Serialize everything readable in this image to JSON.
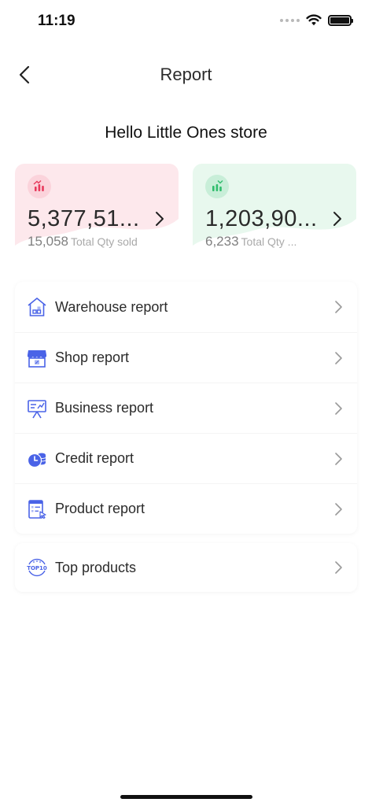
{
  "status_bar": {
    "time": "11:19"
  },
  "nav": {
    "title": "Report"
  },
  "greeting": "Hello Little Ones store",
  "cards": [
    {
      "amount": "5,377,51...",
      "qty": "15,058",
      "label": "Total Qty sold",
      "icon": "bar-chart-up-icon",
      "color": "#fde8ec",
      "accent": "#e8395c"
    },
    {
      "amount": "1,203,90...",
      "qty": "6,233",
      "label": "Total Qty ...",
      "icon": "bar-chart-down-icon",
      "color": "#e8f8ee",
      "accent": "#2fbd6c"
    }
  ],
  "reports": [
    {
      "label": "Warehouse report",
      "icon": "warehouse-icon"
    },
    {
      "label": "Shop report",
      "icon": "shop-icon"
    },
    {
      "label": "Business report",
      "icon": "presentation-board-icon"
    },
    {
      "label": "Credit report",
      "icon": "coins-clock-icon"
    },
    {
      "label": "Product report",
      "icon": "product-list-icon"
    }
  ],
  "top_products": {
    "label": "Top products",
    "icon": "top10-badge-icon",
    "badge_text": "TOP10"
  },
  "colors": {
    "icon_blue": "#4a63e7",
    "text": "#2b2b2b",
    "subtext": "#808080"
  }
}
